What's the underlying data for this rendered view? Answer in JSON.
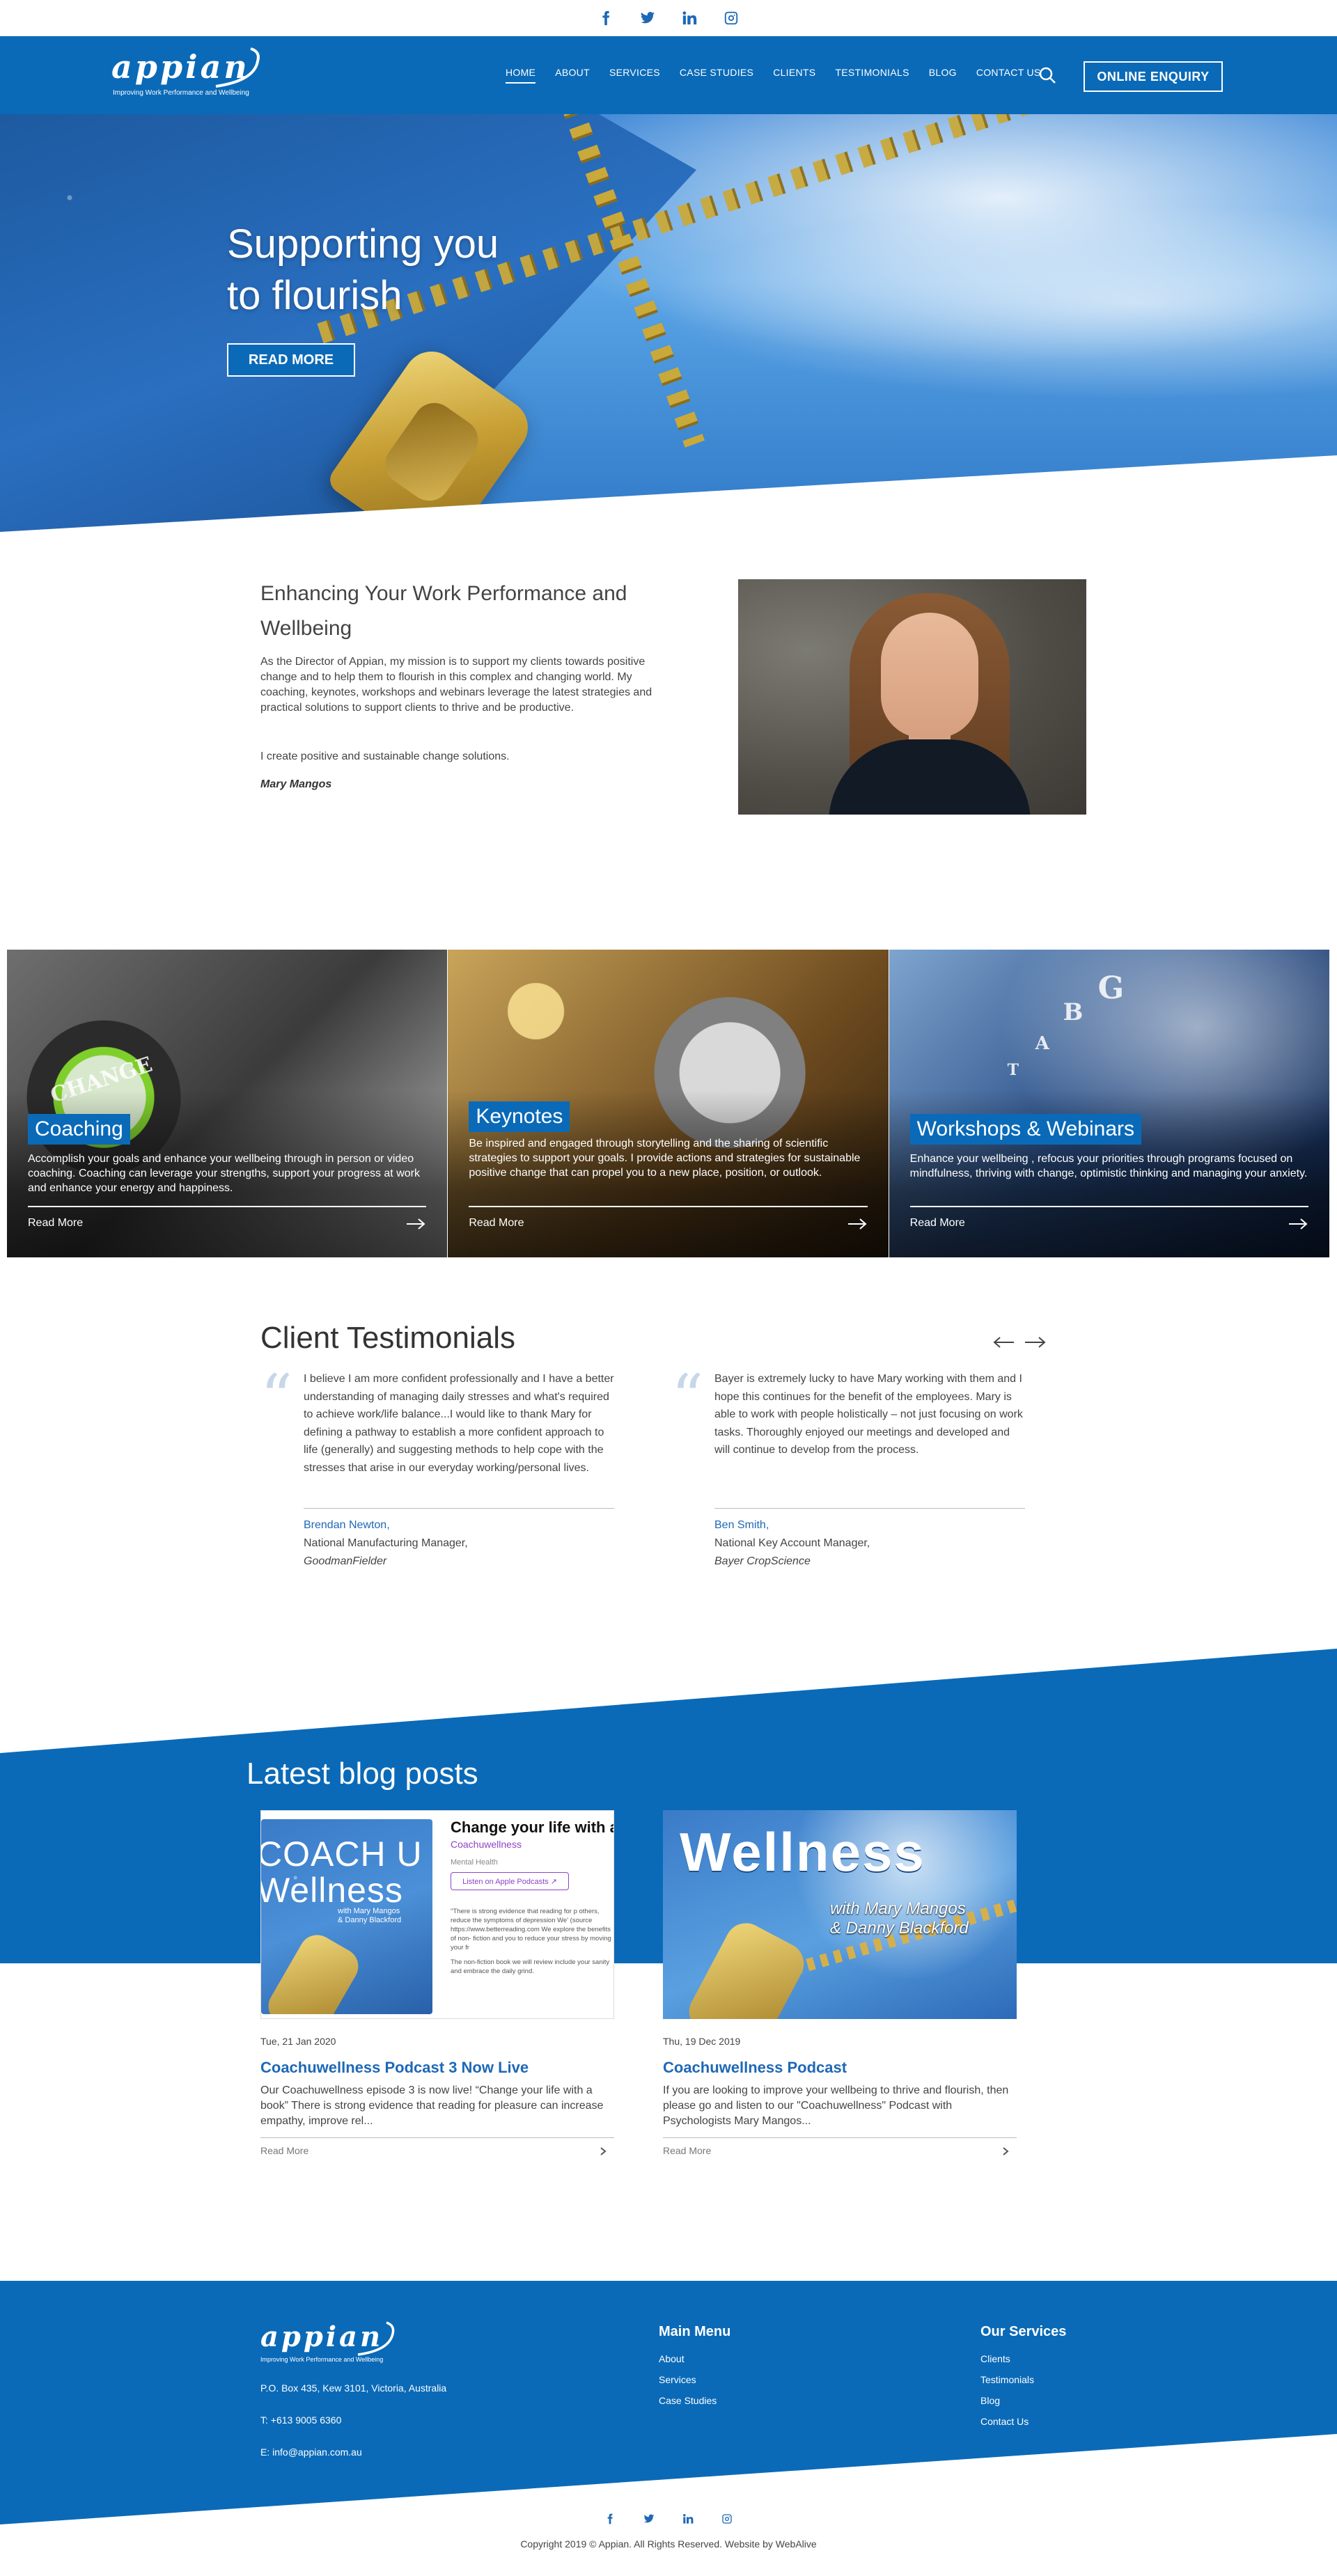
{
  "social": [
    "facebook-icon",
    "twitter-icon",
    "linkedin-icon",
    "instagram-icon"
  ],
  "colors": {
    "brand_blue": "#0a6ab8",
    "link_blue": "#1e68b6",
    "white": "#ffffff"
  },
  "header": {
    "logo_word": "appian",
    "logo_tagline": "Improving Work Performance and Wellbeing",
    "nav": [
      "HOME",
      "ABOUT",
      "SERVICES",
      "CASE STUDIES",
      "CLIENTS",
      "TESTIMONIALS",
      "BLOG",
      "CONTACT US"
    ],
    "active_nav": "HOME",
    "enquiry": "ONLINE ENQUIRY"
  },
  "hero": {
    "title_line1": "Supporting you",
    "title_line2": "to flourish",
    "button": "READ MORE"
  },
  "intro": {
    "title": "Enhancing Your Work Performance and Wellbeing",
    "paragraph1": "As the Director of Appian, my mission is to support my clients towards positive change and to help them to flourish in this complex and changing world. My coaching, keynotes, workshops and webinars leverage the latest strategies and practical solutions to support clients to thrive and be productive.",
    "paragraph2": "I create positive and sustainable change solutions.",
    "signature": "Mary Mangos"
  },
  "services": [
    {
      "title": "Coaching",
      "text": "Accomplish your goals and enhance your wellbeing through in person or video coaching. Coaching can leverage your strengths, support your progress at work and enhance your energy and happiness.",
      "more": "Read More",
      "image_text": "CHANGE"
    },
    {
      "title": "Keynotes",
      "text": "Be inspired and engaged through storytelling and the sharing of scientific strategies to support your goals. I provide actions and strategies for sustainable positive change that can propel you to a new place, position, or outlook.",
      "more": "Read More"
    },
    {
      "title": "Workshops & Webinars",
      "text": "Enhance your wellbeing , refocus your priorities through programs focused on mindfulness, thriving with change, optimistic thinking and managing your anxiety.",
      "more": "Read More"
    }
  ],
  "testimonials": {
    "heading": "Client Testimonials",
    "items": [
      {
        "quote": "I believe I am more confident professionally and I have a better understanding of managing daily stresses and what's required to achieve work/life balance...I would like to thank Mary for defining a pathway to establish a more confident approach to life (generally) and suggesting methods to help cope with the stresses that arise in our everyday working/personal lives.",
        "name": "Brendan Newton,",
        "role": "National Manufacturing Manager,",
        "company": "GoodmanFielder"
      },
      {
        "quote": "Bayer is extremely lucky to have Mary working with them and I hope this continues for the benefit of the employees. Mary is able to work with people holistically – not just focusing on work tasks. Thoroughly enjoyed our meetings and developed and will continue to develop from the process.",
        "name": "Ben Smith,",
        "role": "National Key Account Manager,",
        "company": "Bayer CropScience"
      }
    ]
  },
  "blog": {
    "heading": "Latest blog posts",
    "posts": [
      {
        "date": "Tue, 21 Jan 2020",
        "title": "Coachuwellness Podcast 3 Now Live",
        "excerpt": "Our Coachuwellness episode 3 is now live! “Change your life with a book” There is strong evidence that reading for pleasure can increase empathy, improve rel...",
        "more": "Read More",
        "img": {
          "cover_word1": "COACH U",
          "cover_word2": "Wellness",
          "cover_with": "with Mary Mangos",
          "cover_with2": "& Danny Blackford",
          "side_heading": "Change your life with a",
          "side_sub": "Coachuwellness",
          "side_cat": "Mental Health",
          "side_button": "Listen on Apple Podcasts ↗",
          "side_small1": "\"There is strong evidence that reading for p others, reduce the symptoms of depression We' (source https://www.betterreading.com We explore the benefits of non- fiction and you to reduce your stress by moving your fr",
          "side_small2": "The non-fiction book we will review include your sanity and embrace the daily grind."
        }
      },
      {
        "date": "Thu, 19 Dec 2019",
        "title": "Coachuwellness Podcast",
        "excerpt": "If you are looking to improve your wellbeing to thrive and flourish, then please go and listen to our \"Coachuwellness\" Podcast with Psychologists Mary Mangos...",
        "more": "Read More",
        "img": {
          "title": "Wellness",
          "with1": "with Mary Mangos",
          "with2": "& Danny Blackford"
        }
      }
    ]
  },
  "footer": {
    "logo_word": "appian",
    "logo_tagline": "Improving Work Performance and Wellbeing",
    "address": "P.O. Box 435, Kew 3101, Victoria, Australia",
    "phone": "T: +613 9005 6360",
    "email": "E: info@appian.com.au",
    "main_menu_heading": "Main Menu",
    "main_menu": [
      "About",
      "Services",
      "Case Studies"
    ],
    "services_heading": "Our Services",
    "services": [
      "Clients",
      "Testimonials",
      "Blog",
      "Contact Us"
    ],
    "copyright": "Copyright 2019 © Appian. All Rights Reserved. Website by WebAlive"
  }
}
